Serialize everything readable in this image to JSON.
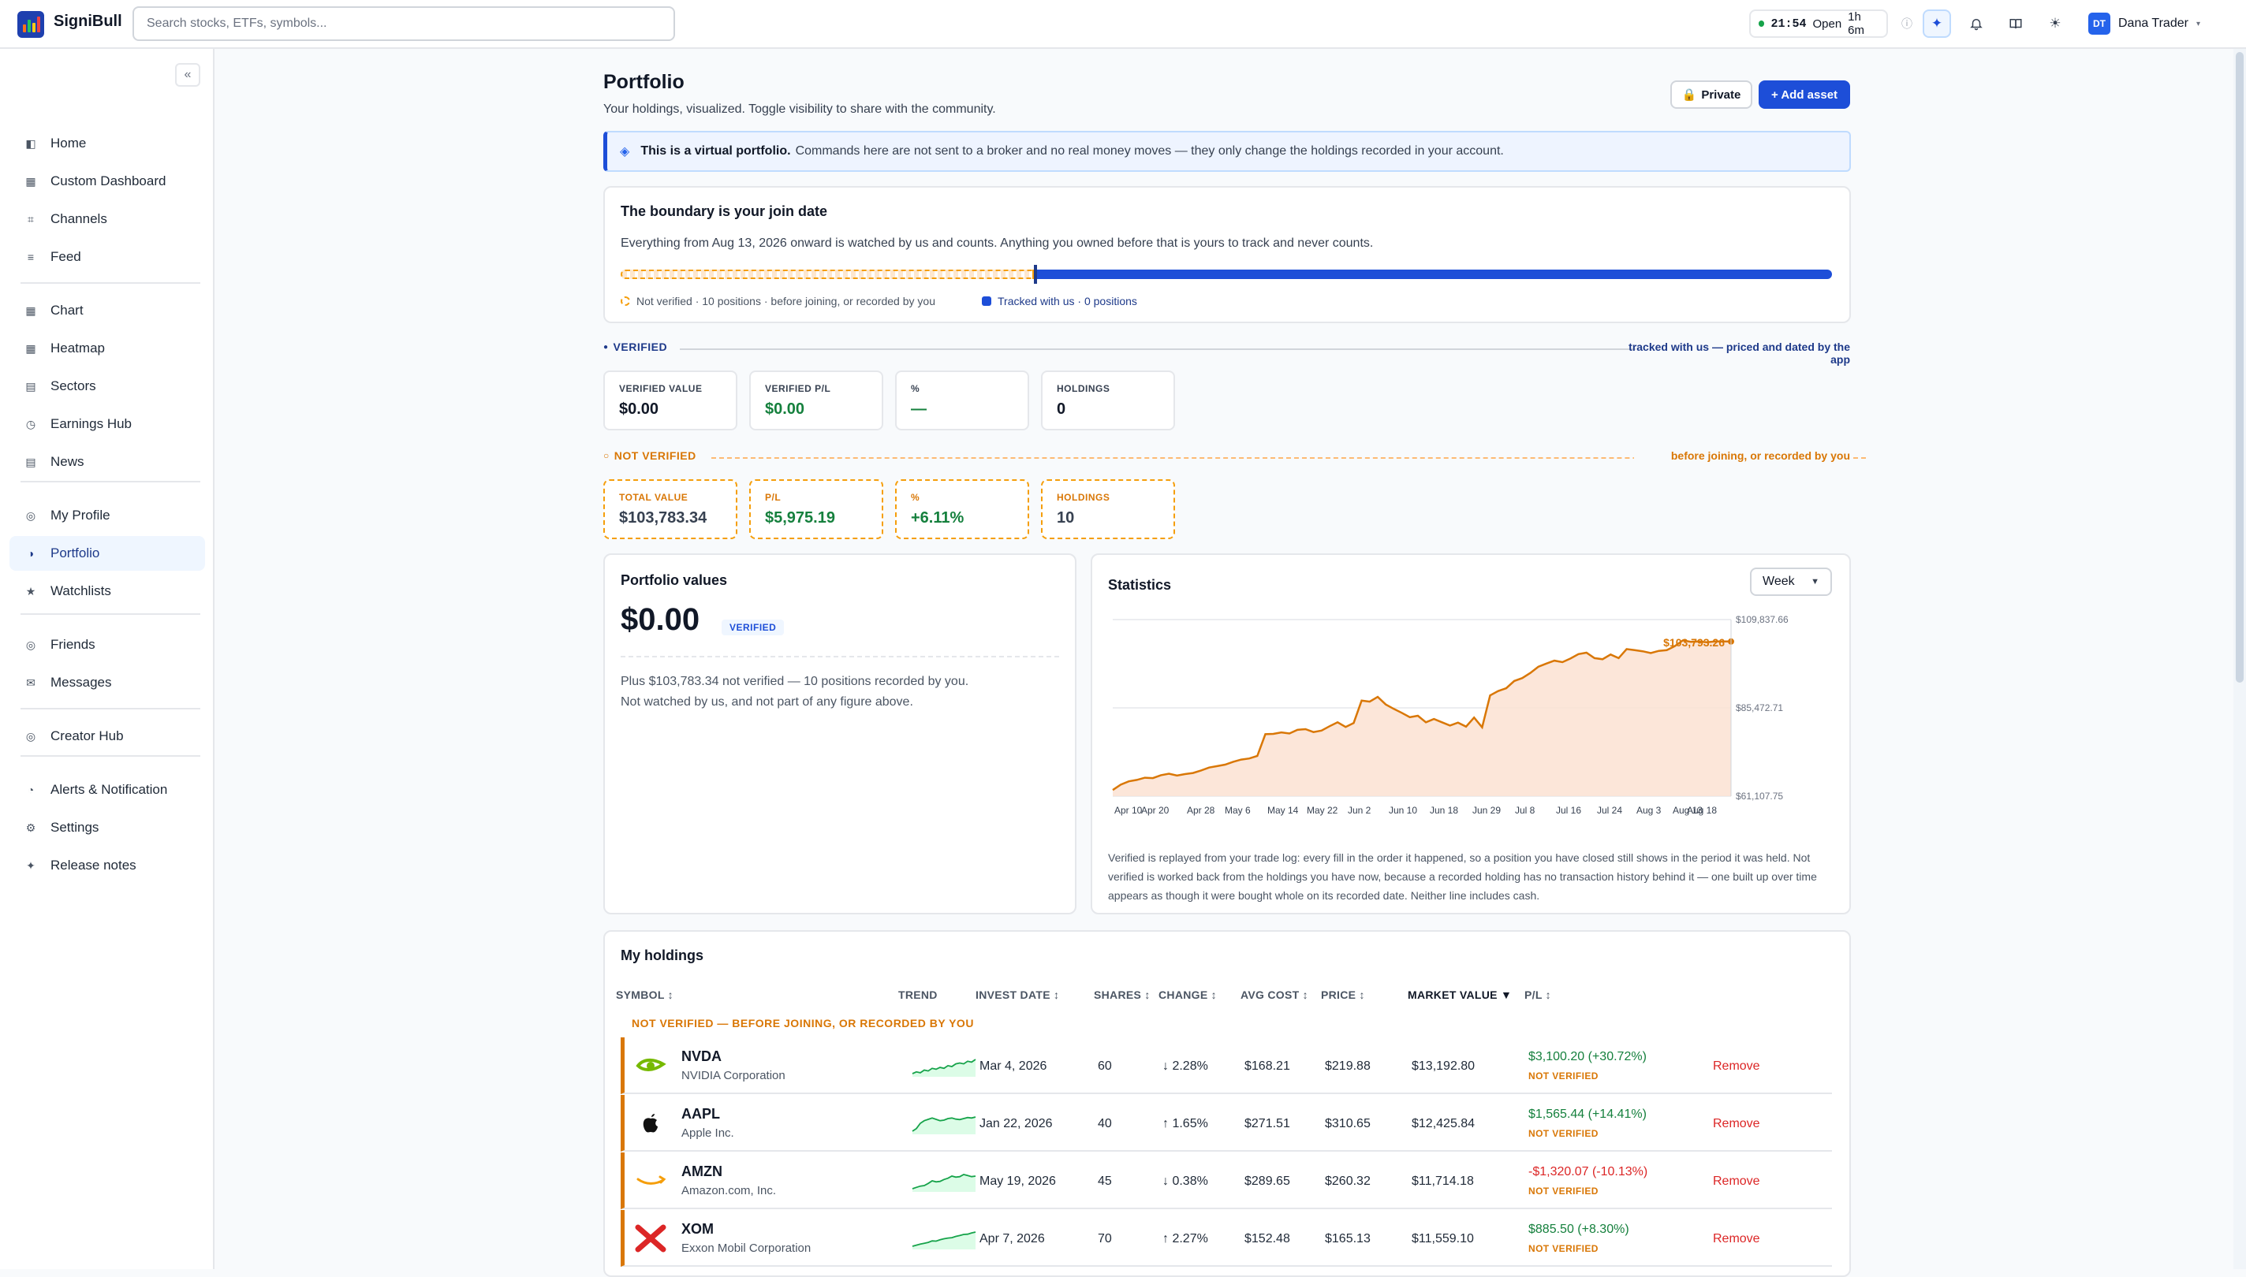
{
  "app": {
    "name": "SigniBull"
  },
  "topbar": {
    "search_placeholder": "Search stocks, ETFs, symbols...",
    "market_time": "21:54",
    "market_status": "Open",
    "market_countdown": "1h 6m",
    "user_initials": "DT",
    "user_name": "Dana Trader"
  },
  "sidebar": {
    "collapse_label": "«",
    "groups": [
      [
        {
          "label": "Home",
          "icon": "◧"
        },
        {
          "label": "Custom Dashboard",
          "icon": "▦"
        },
        {
          "label": "Channels",
          "icon": "⌗"
        },
        {
          "label": "Feed",
          "icon": "≡"
        }
      ],
      [
        {
          "label": "Chart",
          "icon": "▦"
        },
        {
          "label": "Heatmap",
          "icon": "▦"
        },
        {
          "label": "Sectors",
          "icon": "▤"
        },
        {
          "label": "Earnings Hub",
          "icon": "◷"
        },
        {
          "label": "News",
          "icon": "▤"
        }
      ],
      [
        {
          "label": "My Profile",
          "icon": "◎"
        },
        {
          "label": "Portfolio",
          "icon": "◑",
          "active": true
        },
        {
          "label": "Watchlists",
          "icon": "★"
        }
      ],
      [
        {
          "label": "Friends",
          "icon": "◎"
        },
        {
          "label": "Messages",
          "icon": "✉"
        }
      ],
      [
        {
          "label": "Creator Hub",
          "icon": "◎"
        }
      ],
      [
        {
          "label": "Alerts & Notification",
          "icon": "◔"
        },
        {
          "label": "Settings",
          "icon": "⚙"
        },
        {
          "label": "Release notes",
          "icon": "✦"
        }
      ]
    ]
  },
  "page": {
    "title": "Portfolio",
    "subtitle": "Your holdings, visualized. Toggle visibility to share with the community.",
    "private_label": "Private",
    "add_asset_label": "+ Add asset",
    "banner_bold": "This is a virtual portfolio.",
    "banner_text": "Commands here are not sent to a broker and no real money moves — they only change the holdings recorded in your account."
  },
  "boundary": {
    "title": "The boundary is your join date",
    "subtitle": "Everything from Aug 13, 2026 onward is watched by us and counts. Anything you owned before that is yours to track and never counts.",
    "legend_not_verified": "Not verified · 10 positions · before joining, or recorded by you",
    "legend_tracked": "Tracked with us · 0 positions",
    "boundary_fraction": 0.34
  },
  "verified": {
    "heading": "VERIFIED",
    "right_note": "tracked with us — priced and dated by the app",
    "stats": [
      {
        "label": "VERIFIED VALUE",
        "value": "$0.00"
      },
      {
        "label": "VERIFIED P/L",
        "value": "$0.00"
      },
      {
        "label": "%",
        "value": "—"
      },
      {
        "label": "HOLDINGS",
        "value": "0"
      }
    ]
  },
  "not_verified": {
    "heading": "NOT VERIFIED",
    "right_note": "before joining, or recorded by you",
    "stats": [
      {
        "label": "TOTAL VALUE",
        "value": "$103,783.34"
      },
      {
        "label": "P/L",
        "value": "$5,975.19"
      },
      {
        "label": "%",
        "value": "+6.11%"
      },
      {
        "label": "HOLDINGS",
        "value": "10"
      }
    ]
  },
  "portfolio_values": {
    "title": "Portfolio values",
    "value": "$0.00",
    "badge": "VERIFIED",
    "note_line1": "Plus $103,783.34 not verified — 10 positions recorded by you.",
    "note_line2": "Not watched by us, and not part of any figure above."
  },
  "statistics": {
    "title": "Statistics",
    "period": "Week",
    "footnote": "Verified is replayed from your trade log: every fill in the order it happened, so a position you have closed still shows in the period it was held. Not verified is worked back from the holdings you have now, because a recorded holding has no transaction history behind it — one built up over time appears as though it were bought whole on its recorded date. Neither line includes cash."
  },
  "chart_data": {
    "type": "area",
    "title": "",
    "xlabel": "",
    "ylabel": "",
    "x_ticks": [
      "Apr 10",
      "Apr 20",
      "Apr 28",
      "May 6",
      "May 14",
      "May 22",
      "Jun 2",
      "Jun 10",
      "Jun 18",
      "Jun 29",
      "Jul 8",
      "Jul 16",
      "Jul 24",
      "Aug 3",
      "Aug 13",
      "Aug 18"
    ],
    "y_ticks": [
      "$109,837.66",
      "$85,472.71",
      "$61,107.75"
    ],
    "ylim": [
      61107.75,
      109837.66
    ],
    "end_label": "$103,793.26",
    "series": [
      {
        "color": "#d97706",
        "values": [
          62800,
          64300,
          65200,
          65600,
          66200,
          66100,
          66900,
          67300,
          66800,
          67200,
          67500,
          68200,
          69000,
          69400,
          69800,
          70600,
          71200,
          71500,
          72200,
          78200,
          78300,
          78700,
          78400,
          79400,
          79600,
          78800,
          79200,
          80400,
          81500,
          80200,
          81300,
          87500,
          87200,
          88500,
          86400,
          85200,
          84100,
          82900,
          83300,
          81500,
          82400,
          81500,
          80600,
          81400,
          80300,
          82800,
          80100,
          88900,
          90100,
          90900,
          92900,
          93700,
          95100,
          96800,
          97700,
          98500,
          98100,
          99100,
          100300,
          100700,
          99200,
          98900,
          100200,
          99200,
          101700,
          101400,
          101100,
          100600,
          101200,
          101400,
          102500,
          104100,
          103700,
          103800,
          103600,
          103800,
          103800,
          103793
        ]
      }
    ]
  },
  "holdings": {
    "title": "My holdings",
    "columns": [
      "SYMBOL ↕",
      "TREND",
      "INVEST DATE ↕",
      "SHARES ↕",
      "CHANGE ↕",
      "AVG COST ↕",
      "PRICE ↕",
      "MARKET VALUE ▼",
      "P/L ↕"
    ],
    "group_label": "NOT VERIFIED — BEFORE JOINING, OR RECORDED BY YOU",
    "remove_label": "Remove",
    "rows": [
      {
        "symbol": "NVDA",
        "name": "NVIDIA Corporation",
        "logo": "nvidia-logo",
        "date": "Mar 4, 2026",
        "shares": "60",
        "change": "↓ 2.28%",
        "dir": "dn",
        "avg": "$168.21",
        "price": "$219.88",
        "mv": "$13,192.80",
        "pl": "$3,100.20 (+30.72%)",
        "pl_dir": "up",
        "badge": "NOT VERIFIED",
        "trend": [
          2,
          3,
          2.5,
          4,
          3.5,
          5,
          4.5,
          5.5,
          5,
          6.5,
          6,
          7.5,
          8,
          7.5,
          9,
          8.5,
          10
        ]
      },
      {
        "symbol": "AAPL",
        "name": "Apple Inc.",
        "logo": "apple-logo",
        "date": "Jan 22, 2026",
        "shares": "40",
        "change": "↑ 1.65%",
        "dir": "up",
        "avg": "$271.51",
        "price": "$310.65",
        "mv": "$12,425.84",
        "pl": "$1,565.44 (+14.41%)",
        "pl_dir": "up",
        "badge": "NOT VERIFIED",
        "trend": [
          3,
          4,
          6,
          7,
          7.5,
          8,
          7.5,
          7,
          7.2,
          7.8,
          8,
          7.6,
          7.4,
          7.8,
          8.2,
          8,
          8.4
        ]
      },
      {
        "symbol": "AMZN",
        "name": "Amazon.com, Inc.",
        "logo": "amazon-logo",
        "date": "May 19, 2026",
        "shares": "45",
        "change": "↓ 0.38%",
        "dir": "dn",
        "avg": "$289.65",
        "price": "$260.32",
        "mv": "$11,714.18",
        "pl": "-$1,320.07 (-10.13%)",
        "pl_dir": "dn",
        "badge": "NOT VERIFIED",
        "trend": [
          3,
          3.5,
          4,
          4.2,
          5,
          6,
          5.6,
          5.8,
          6.5,
          7,
          7.8,
          7.4,
          7.6,
          8.4,
          8,
          7.6,
          7.8
        ]
      },
      {
        "symbol": "XOM",
        "name": "Exxon Mobil Corporation",
        "logo": "exxon-logo",
        "date": "Apr 7, 2026",
        "shares": "70",
        "change": "↑ 2.27%",
        "dir": "up",
        "avg": "$152.48",
        "price": "$165.13",
        "mv": "$11,559.10",
        "pl": "$885.50 (+8.30%)",
        "pl_dir": "up",
        "badge": "NOT VERIFIED",
        "trend": [
          2,
          2.5,
          3,
          3.4,
          3.8,
          4.5,
          4.4,
          5,
          5.5,
          5.8,
          6,
          6.6,
          7,
          7.5,
          7.6,
          8.2,
          8.6
        ]
      }
    ]
  },
  "colors": {
    "accent": "#1d4ed8",
    "not_verified": "#d97706",
    "gain": "#15803d",
    "loss": "#dc2626"
  }
}
